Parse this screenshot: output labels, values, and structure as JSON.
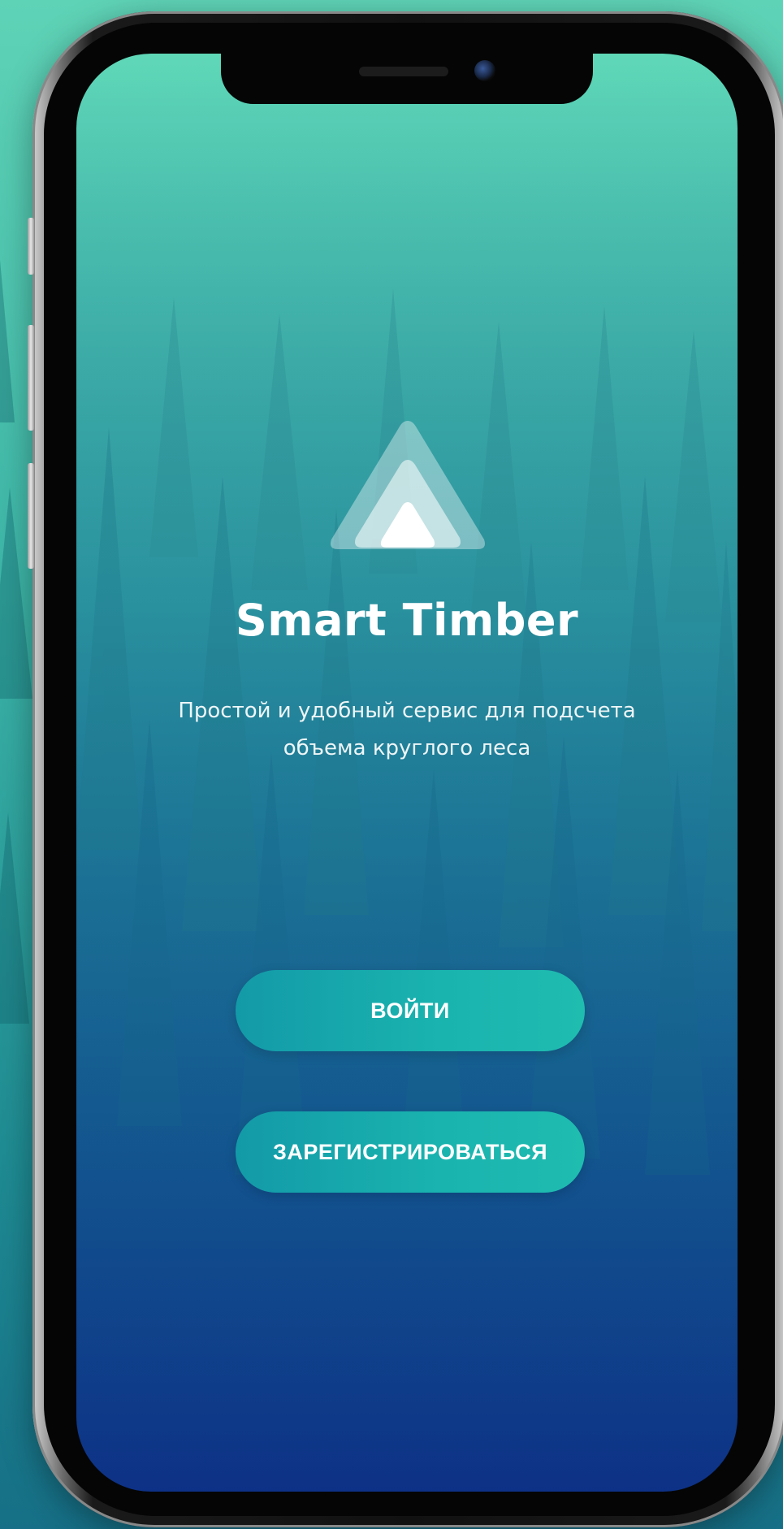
{
  "app": {
    "title": "Smart Timber",
    "subtitle_line1": "Простой и удобный сервис для подсчета",
    "subtitle_line2": "объема круглого леса"
  },
  "actions": {
    "login_label": "ВОЙТИ",
    "register_label": "ЗАРЕГИСТРИРОВАТЬСЯ"
  },
  "icons": {
    "logo": "triangle-logo-icon",
    "camera": "front-camera-icon"
  },
  "colors": {
    "screen_top": "#5fd8b8",
    "screen_bottom": "#0d2f86",
    "button": "#1ab4af",
    "text": "#ffffff"
  }
}
